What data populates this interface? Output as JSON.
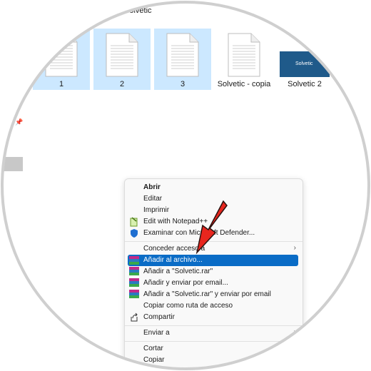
{
  "window": {
    "title": "Solvetic"
  },
  "files": [
    {
      "name": "1",
      "selected": true
    },
    {
      "name": "2",
      "selected": true
    },
    {
      "name": "3",
      "selected": true
    },
    {
      "name": "Solvetic - copia",
      "selected": false
    },
    {
      "name": "Solvetic 2",
      "selected": false,
      "thumb_text": "Solvetic"
    }
  ],
  "context_menu": {
    "items": [
      {
        "label": "Abrir",
        "bold": true,
        "icon": ""
      },
      {
        "label": "Editar",
        "icon": ""
      },
      {
        "label": "Imprimir",
        "icon": ""
      },
      {
        "label": "Edit with Notepad++",
        "icon": "notepadpp-icon"
      },
      {
        "label": "Examinar con Microsoft Defender...",
        "icon": "defender-shield-icon"
      },
      {
        "label": "Conceder acceso a",
        "icon": "",
        "submenu": true
      },
      {
        "label": "Añadir al archivo...",
        "icon": "winrar-icon",
        "highlighted": true
      },
      {
        "label": "Añadir a \"Solvetic.rar\"",
        "icon": "winrar-icon"
      },
      {
        "label": "Añadir y enviar por email...",
        "icon": "winrar-icon"
      },
      {
        "label": "Añadir a \"Solvetic.rar\" y enviar por email",
        "icon": "winrar-icon"
      },
      {
        "label": "Copiar como ruta de acceso",
        "icon": ""
      },
      {
        "label": "Compartir",
        "icon": "share-icon"
      },
      {
        "label": "Enviar a",
        "icon": "",
        "submenu": true
      },
      {
        "label": "Cortar",
        "icon": ""
      },
      {
        "label": "Copiar",
        "icon": ""
      }
    ]
  },
  "colors": {
    "selection": "#cce8ff",
    "highlight": "#0a6cc6",
    "arrow": "#e8261e"
  }
}
